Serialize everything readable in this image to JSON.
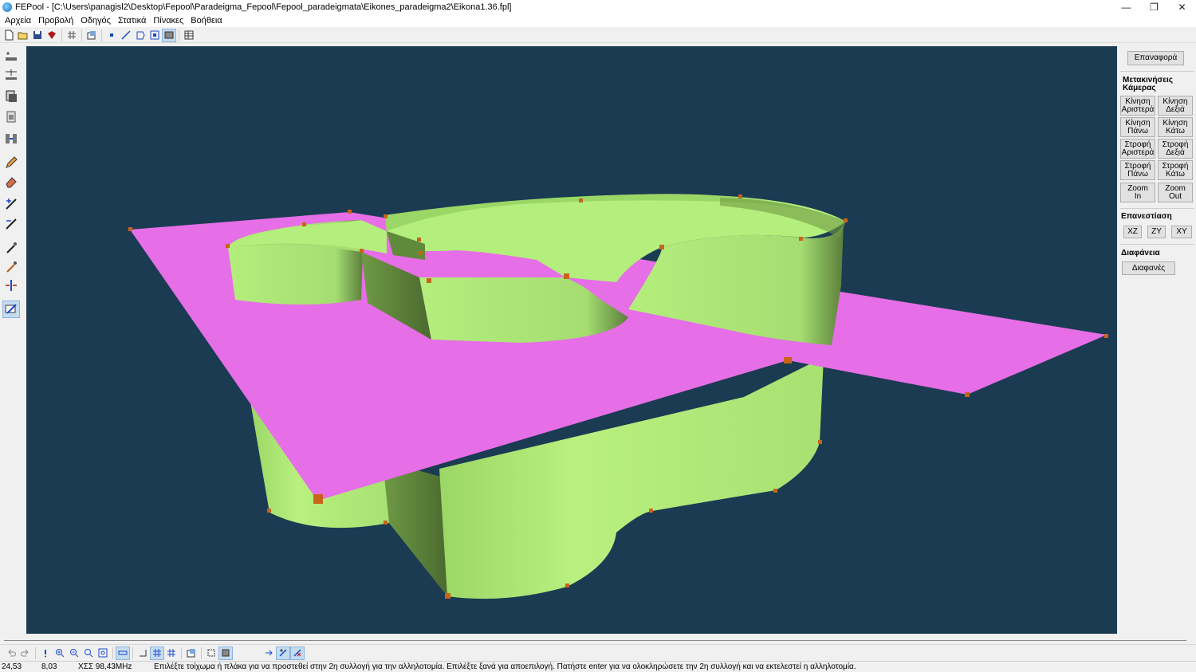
{
  "window": {
    "app_name": "FEPool",
    "title": "FEPool - [C:\\Users\\panagisl2\\Desktop\\Fepool\\Paradeigma_Fepool\\Fepool_paradeigmata\\Eikones_paradeigma2\\Eikona1.36.fpl]",
    "controls": {
      "minimize": "—",
      "restore": "❐",
      "close": "✕"
    }
  },
  "menu": [
    "Αρχεία",
    "Προβολή",
    "Οδηγός",
    "Στατικά",
    "Πίνακες",
    "Βοήθεια"
  ],
  "right_panel": {
    "reset_label": "Επαναφορά",
    "camera_heading": "Μετακινήσεις Κάμερας",
    "camera_buttons": [
      {
        "line1": "Κίνηση",
        "line2": "Αριστερά"
      },
      {
        "line1": "Κίνηση",
        "line2": "Δεξιά"
      },
      {
        "line1": "Κίνηση",
        "line2": "Πάνω"
      },
      {
        "line1": "Κίνηση",
        "line2": "Κάτω"
      },
      {
        "line1": "Στροφή",
        "line2": "Αριστερά"
      },
      {
        "line1": "Στροφή",
        "line2": "Δεξιά"
      },
      {
        "line1": "Στροφή",
        "line2": "Πάνω"
      },
      {
        "line1": "Στροφή",
        "line2": "Κάτω"
      },
      {
        "line1": "Zoom",
        "line2": "In"
      },
      {
        "line1": "Zoom",
        "line2": "Out"
      }
    ],
    "reorient_heading": "Επανεστίαση",
    "reorient_buttons": [
      "XZ",
      "ZY",
      "XY"
    ],
    "transparency_heading": "Διαφάνεια",
    "transparency_button": "Διαφανές"
  },
  "status": {
    "x": "24,53",
    "y": "8,03",
    "memory": "ΧΣΣ 98,43MHz",
    "message": "Επιλέξτε τοίχωμα ή πλάκα για να προστεθεί στην 2η συλλογή για την αλληλοτομία. Επιλέξτε ξανά για αποεπιλογή. Πατήστε enter για να ολοκληρώσετε την 2η συλλογή και να εκτελεστεί η αλληλοτομία."
  },
  "colors": {
    "viewport_bg": "#1a3b52",
    "wall_green": "#b4ee7c",
    "plane_magenta": "#e66ee6",
    "node_orange": "#c8641a"
  }
}
